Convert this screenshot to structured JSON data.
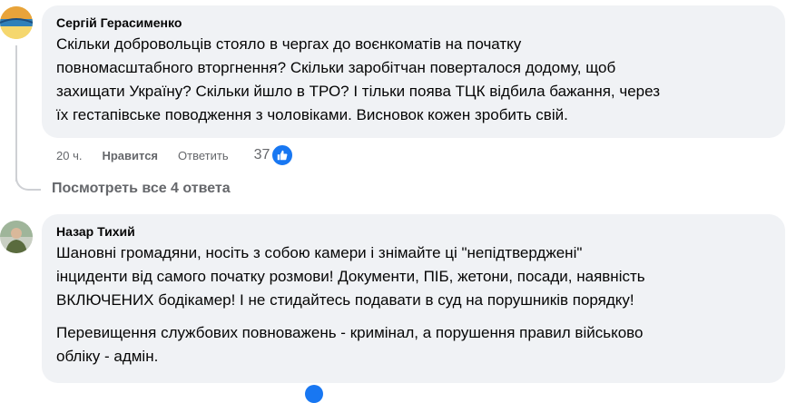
{
  "comment1": {
    "author": "Сергій Герасименко",
    "text": "Скільки добровольців стояло в чергах до воєнкоматів на початку повномасштабного вторгнення? Скільки заробітчан поверталося додому, щоб захищати Україну? Скільки йшло в ТРО? І тільки поява ТЦК відбила бажання, через їх гестапівське поводження з чоловіками. Висновок кожен зробить свій.",
    "lines": [
      "Скільки добровольців стояло в чергах до воєнкоматів на початку",
      "повномасштабного вторгнення? Скільки заробітчан поверталося додому, щоб",
      "захищати Україну? Скільки йшло в ТРО? І тільки поява ТЦК відбила бажання, через",
      "їх гестапівське поводження з чоловіками. Висновок кожен зробить свій."
    ],
    "time": "20 ч.",
    "like_label": "Нравится",
    "reply_label": "Ответить",
    "reaction_count": "37",
    "reaction_icon": "thumbs-up-icon",
    "accent_color": "#1877f2"
  },
  "replies_link": "Посмотреть все 4 ответа",
  "comment2": {
    "author": "Назар Тихий",
    "paragraph1_lines": [
      "Шановні громадяни, носіть з собою камери і знімайте ці \"непідтверджені\"",
      "інциденти від самого початку розмови! Документи, ПІБ, жетони, посади, наявність",
      "ВКЛЮЧЕНИХ бодікамер! І не стидайтесь подавати в суд на порушників порядку!"
    ],
    "paragraph2_lines": [
      "Перевищення службових повноважень - кримінал, а порушення правил військово",
      "обліку - адмін."
    ]
  }
}
